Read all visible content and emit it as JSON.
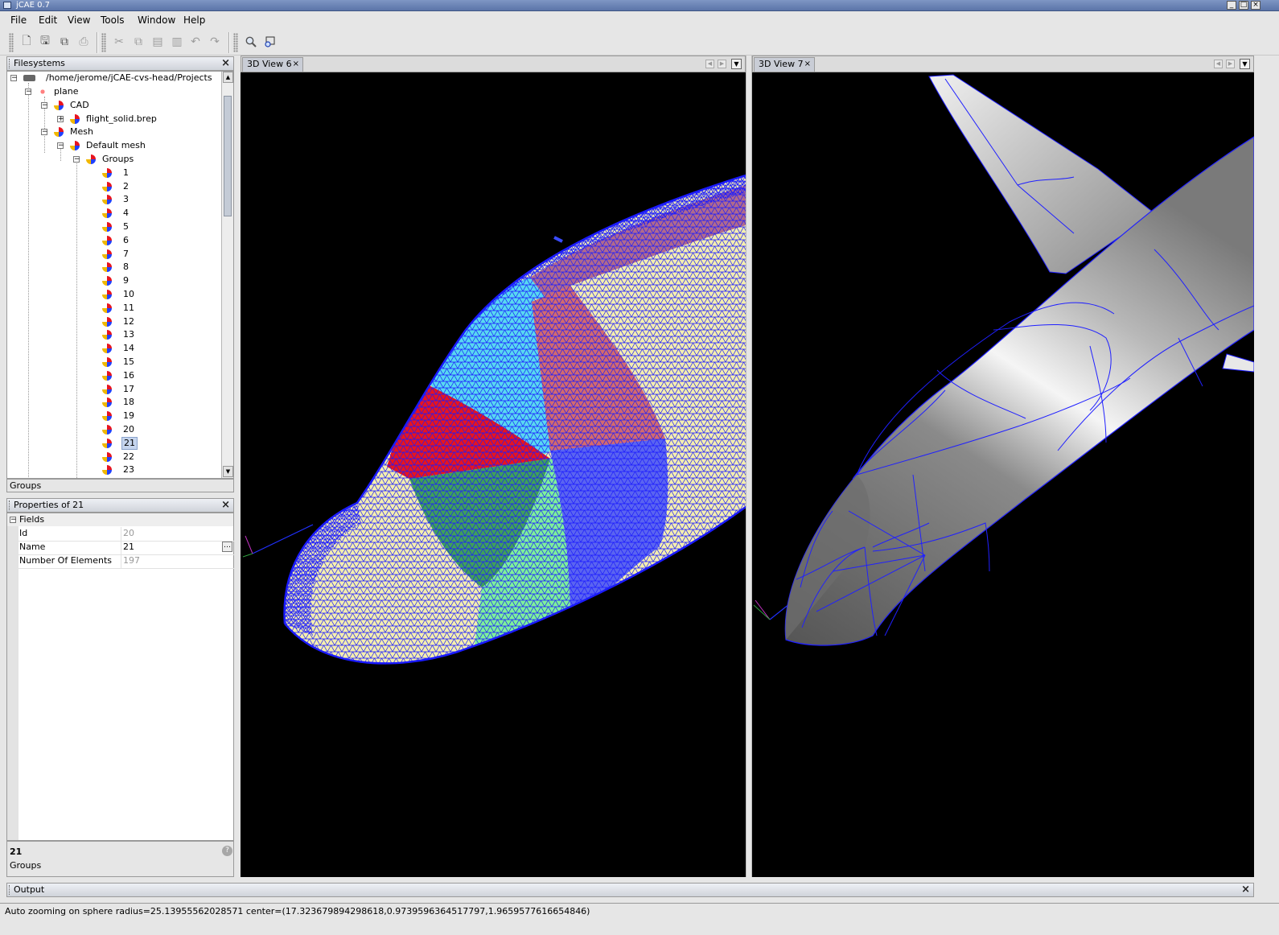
{
  "window": {
    "title": "jCAE 0.7"
  },
  "menubar": [
    "File",
    "Edit",
    "View",
    "Tools",
    "Window",
    "Help"
  ],
  "toolbar": {
    "groups": [
      [
        {
          "icon": "new-file-icon",
          "enabled": true
        },
        {
          "icon": "save-icon",
          "enabled": true
        },
        {
          "icon": "save-all-icon",
          "enabled": true
        },
        {
          "icon": "print-icon",
          "enabled": false
        }
      ],
      [
        {
          "icon": "cut-icon",
          "enabled": false
        },
        {
          "icon": "copy-icon",
          "enabled": false
        },
        {
          "icon": "paste-icon",
          "enabled": false
        },
        {
          "icon": "delete-icon",
          "enabled": false
        },
        {
          "icon": "undo-icon",
          "enabled": false
        },
        {
          "icon": "redo-icon",
          "enabled": false
        }
      ],
      [
        {
          "icon": "search-icon",
          "enabled": true
        },
        {
          "icon": "zoom-window-icon",
          "enabled": true
        }
      ]
    ]
  },
  "filesystems": {
    "title": "Filesystems",
    "root": "/home/jerome/jCAE-cvs-head/Projects",
    "tree": [
      {
        "label": "plane",
        "level": 1,
        "expander": "-",
        "icon": "project-icon"
      },
      {
        "label": "CAD",
        "level": 2,
        "expander": "-",
        "icon": "cad-icon"
      },
      {
        "label": "flight_solid.brep",
        "level": 3,
        "expander": "+",
        "icon": "brep-icon"
      },
      {
        "label": "Mesh",
        "level": 2,
        "expander": "-",
        "icon": "mesh-icon"
      },
      {
        "label": "Default mesh",
        "level": 3,
        "expander": "-",
        "icon": "mesh-icon"
      },
      {
        "label": "Groups",
        "level": 4,
        "expander": "-",
        "icon": "groups-icon"
      }
    ],
    "groups": [
      "1",
      "2",
      "3",
      "4",
      "5",
      "6",
      "7",
      "8",
      "9",
      "10",
      "11",
      "12",
      "13",
      "14",
      "15",
      "16",
      "17",
      "18",
      "19",
      "20",
      "21",
      "22",
      "23"
    ],
    "selected_group": "21",
    "footer": "Groups"
  },
  "properties": {
    "title": "Properties of 21",
    "section": "Fields",
    "rows": [
      {
        "key": "Id",
        "value": "20",
        "editable": false
      },
      {
        "key": "Name",
        "value": "21",
        "editable": true
      },
      {
        "key": "Number Of Elements",
        "value": "197",
        "editable": false
      }
    ],
    "desc_title": "21",
    "desc_text": "Groups",
    "help_icon": "help-icon"
  },
  "views": [
    {
      "tab": "3D View 6"
    },
    {
      "tab": "3D View 7"
    }
  ],
  "output": {
    "title": "Output",
    "message": "Auto zooming on sphere radius=25.13955562028571 center=(17.323679894298618,0.9739596364517797,1.9659577616654846)"
  },
  "colors": {
    "mesh_line": "#1a1aff",
    "face_yellow": "#f4eeae",
    "face_red": "#e8141e",
    "face_cyan": "#58d8f0",
    "face_salmon": "#d26a6e",
    "face_green": "#3fa05a",
    "face_light_green": "#7ef09a",
    "face_blue": "#5a64f0",
    "face_mauve": "#b06a8c",
    "surface_gray": "#8c8c8c",
    "selection": "#c5d5ee",
    "titlebar": "#5b74a8"
  }
}
